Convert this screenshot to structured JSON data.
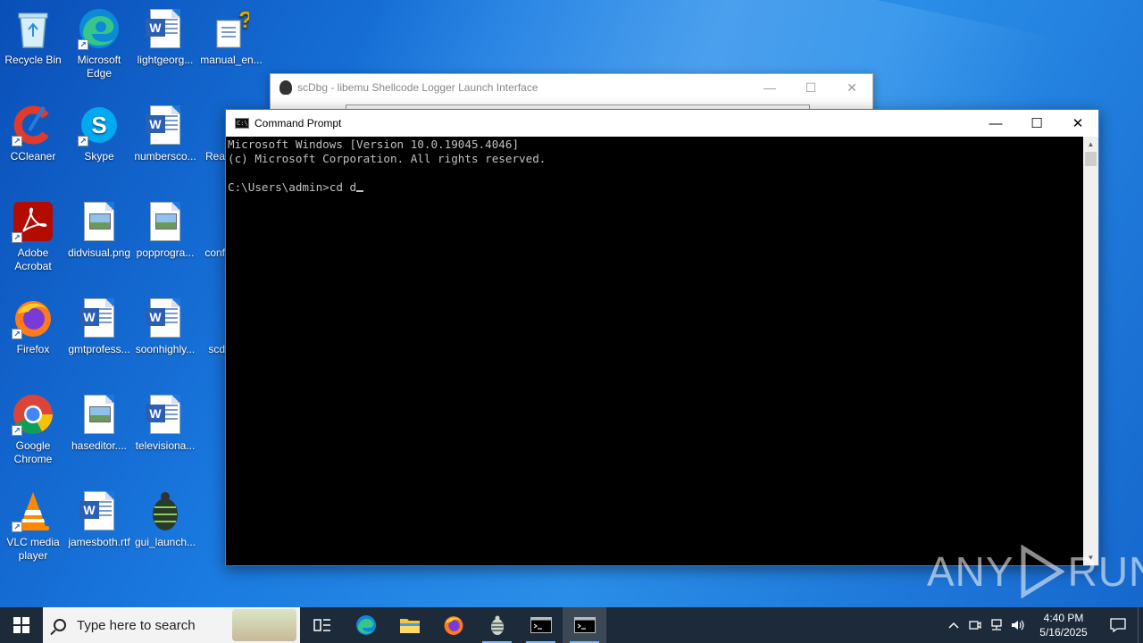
{
  "desktop": {
    "icons": [
      {
        "label": "Recycle Bin",
        "icon": "recycle-bin-icon"
      },
      {
        "label": "Microsoft Edge",
        "icon": "edge-icon"
      },
      {
        "label": "lightgeorg...",
        "icon": "word-doc-icon"
      },
      {
        "label": "manual_en...",
        "icon": "help-doc-icon"
      },
      {
        "label": "CCleaner",
        "icon": "ccleaner-icon"
      },
      {
        "label": "Skype",
        "icon": "skype-icon"
      },
      {
        "label": "numbersco...",
        "icon": "word-doc-icon"
      },
      {
        "label": "Rea",
        "icon": "doc-icon"
      },
      {
        "label": "Adobe Acrobat",
        "icon": "acrobat-icon"
      },
      {
        "label": "didvisual.png",
        "icon": "image-file-icon"
      },
      {
        "label": "popprogra...",
        "icon": "image-file-icon"
      },
      {
        "label": "conf",
        "icon": "doc-icon"
      },
      {
        "label": "Firefox",
        "icon": "firefox-icon"
      },
      {
        "label": "gmtprofess...",
        "icon": "word-doc-icon"
      },
      {
        "label": "soonhighly...",
        "icon": "word-doc-icon"
      },
      {
        "label": "scd",
        "icon": "scdbg-icon"
      },
      {
        "label": "Google Chrome",
        "icon": "chrome-icon"
      },
      {
        "label": "haseditor....",
        "icon": "image-file-icon"
      },
      {
        "label": "televisiona...",
        "icon": "word-doc-icon"
      },
      {
        "label": "VLC media player",
        "icon": "vlc-icon"
      },
      {
        "label": "jamesboth.rtf",
        "icon": "word-doc-icon"
      },
      {
        "label": "gui_launch...",
        "icon": "scdbg-icon"
      }
    ]
  },
  "background_window": {
    "title": "scDbg - libemu Shellcode Logger Launch Interface",
    "minimize": "—",
    "maximize": "☐",
    "close": "✕"
  },
  "cmd_window": {
    "title": "Command Prompt",
    "minimize": "—",
    "maximize": "☐",
    "close": "✕",
    "lines": [
      "Microsoft Windows [Version 10.0.19045.4046]",
      "(c) Microsoft Corporation. All rights reserved.",
      "",
      "C:\\Users\\admin>cd d"
    ]
  },
  "watermark": {
    "left": "ANY",
    "right": "RUN"
  },
  "taskbar": {
    "search_placeholder": "Type here to search",
    "apps": [
      "task-view-icon",
      "edge-icon",
      "file-explorer-icon",
      "firefox-icon",
      "scdbg-icon",
      "cmd-icon",
      "cmd-icon"
    ],
    "clock_time": "4:40 PM",
    "clock_date": "5/16/2025"
  },
  "colors": {
    "desktop_accent": "#1a7ae0",
    "taskbar": "#1c2a3a",
    "console_bg": "#000000",
    "console_text": "#c0c0c0"
  }
}
